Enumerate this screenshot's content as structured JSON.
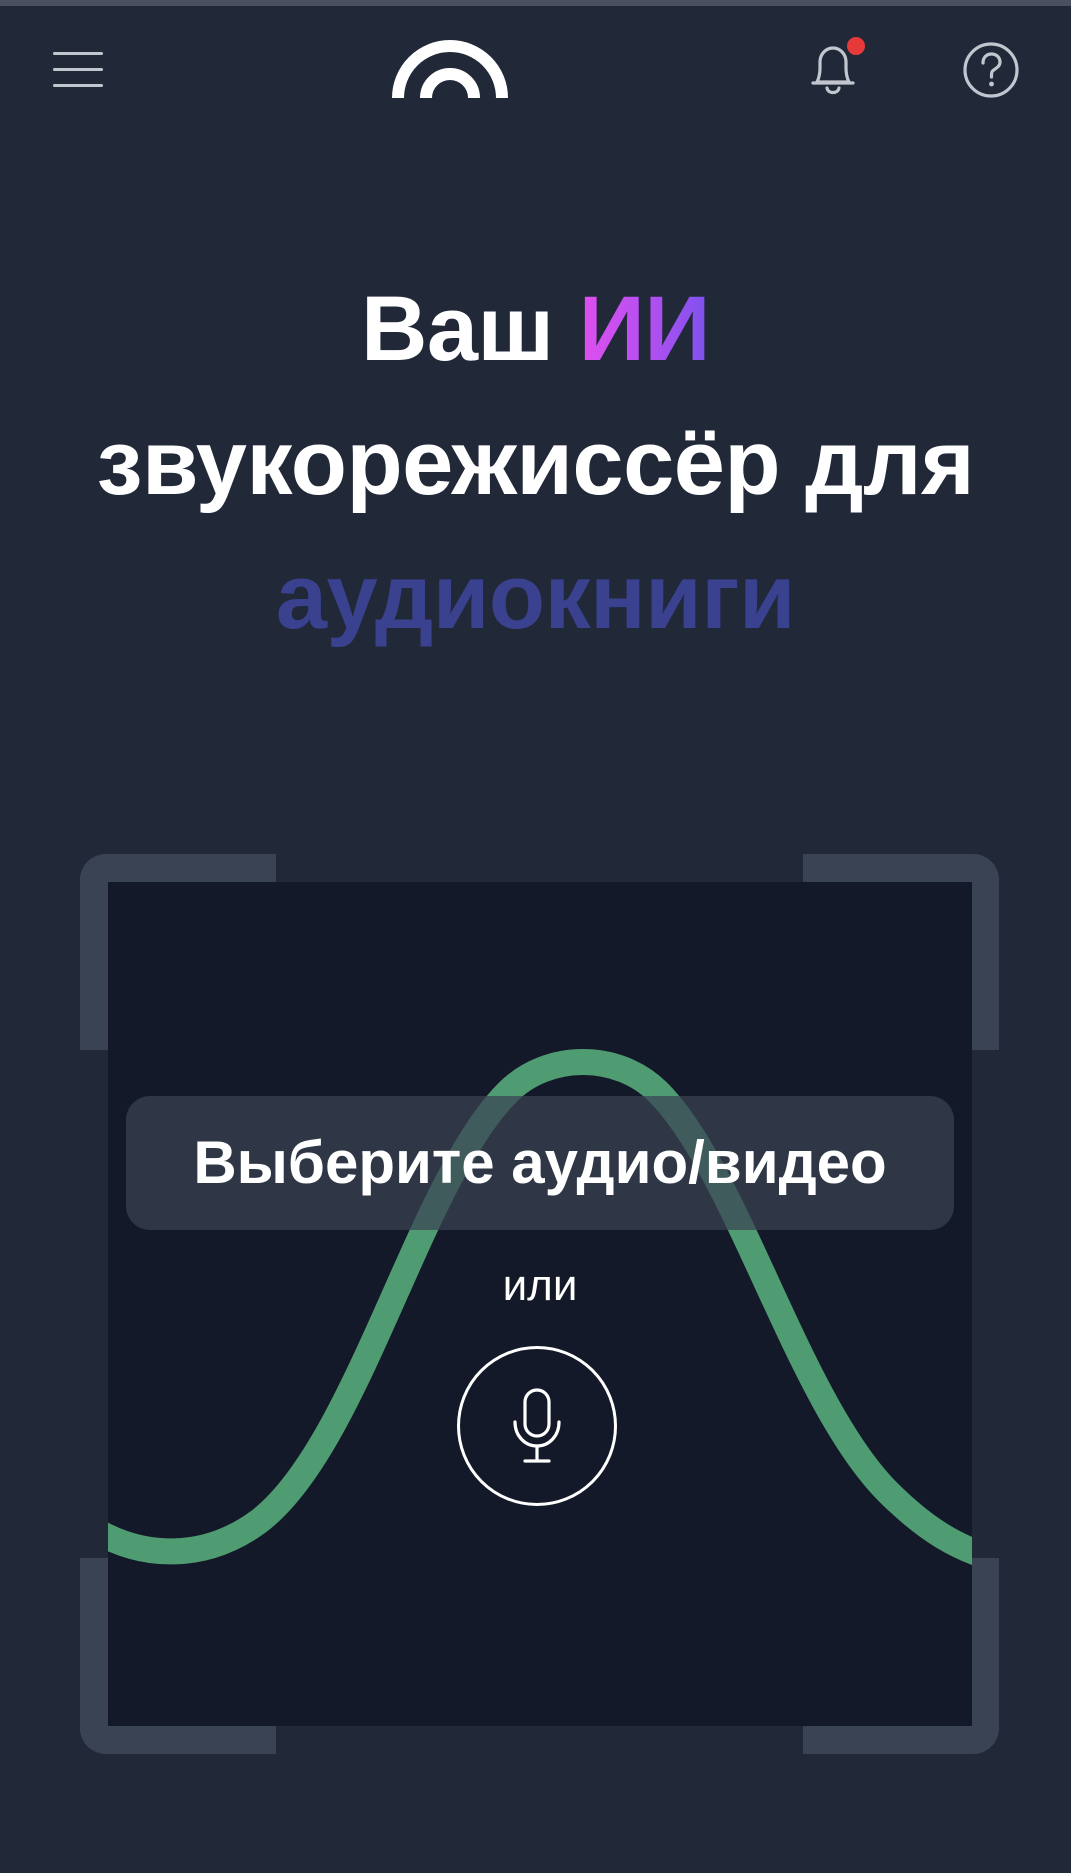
{
  "header": {
    "menu_icon": "hamburger-menu-icon",
    "logo_icon": "arc-logo-icon",
    "notifications_icon": "bell-icon",
    "has_unread_notifications": true,
    "help_icon": "question-circle-icon"
  },
  "hero": {
    "line1_prefix": "Ваш",
    "line1_accent": "ИИ",
    "line2": "звукорежиссёр для",
    "line3": "аудиокниги"
  },
  "upload": {
    "select_label": "Выберите аудио/видео",
    "or_label": "или",
    "record_icon": "microphone-icon"
  },
  "colors": {
    "background": "#212838",
    "drop_area": "#131928",
    "accent_gradient_start": "#e14ff0",
    "accent_gradient_end": "#7b52ee",
    "muted_word": "#3a4290",
    "wave": "#4f9b72",
    "notification_dot": "#e5393a"
  }
}
